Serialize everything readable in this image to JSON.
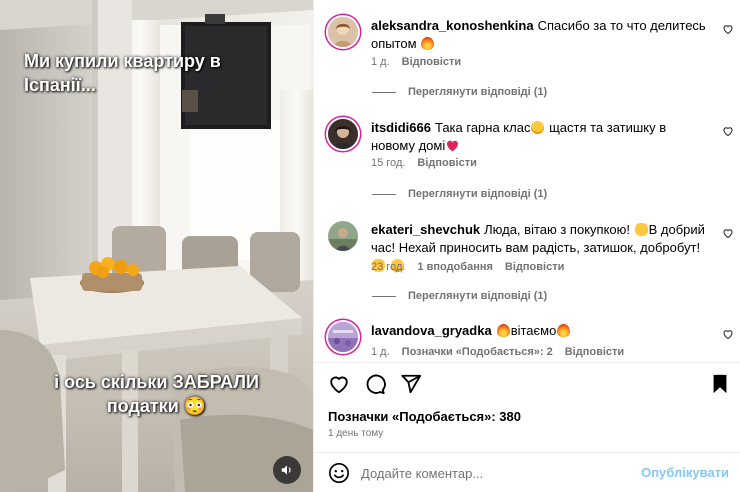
{
  "media": {
    "caption_top": "Ми купили квартиру в Іспанії...",
    "caption_bottom_1": "і ось скільки ЗАБРАЛИ",
    "caption_bottom_2": "податки 😳",
    "sound_icon": "speaker-icon"
  },
  "comments": [
    {
      "username": "aleksandra_konoshenkina",
      "text": "Спасибо за то что делитесь опытом",
      "text_emoji": "fire",
      "age": "1 д.",
      "reply": "Відповісти",
      "likes": "",
      "view_replies": "Переглянути відповіді (1)"
    },
    {
      "username": "itsdidi666",
      "text": "Така гарна клас",
      "text_mid": " щастя та затишку в новому домі",
      "text_emoji": "star-struck",
      "text_emoji_2": "red-heart",
      "age": "15 год.",
      "reply": "Відповісти",
      "likes": "",
      "view_replies": "Переглянути відповіді (1)"
    },
    {
      "username": "ekateri_shevchuk",
      "text": "Люда, вітаю з покупкою! ",
      "text_mid": "В добрий час! Нехай приносить вам радість, затишок, добробут! ",
      "text_emoji": "raising-hands",
      "age": "23 год.",
      "likes": "1 вподобання",
      "reply": "Відповісти",
      "view_replies": "Переглянути відповіді (1)"
    },
    {
      "username": "lavandova_gryadka",
      "text": "вітаємо",
      "text_emoji": "fire",
      "age": "1 д.",
      "likes": "Позначки «Подобається»: 2",
      "reply": "Відповісти"
    }
  ],
  "actions": {
    "like_icon": "heart-icon",
    "comment_icon": "comment-icon",
    "share_icon": "paper-plane-icon",
    "save_icon": "bookmark-icon",
    "likes_text": "Позначки «Подобається»: 380",
    "time": "1 день тому"
  },
  "add_comment": {
    "placeholder": "Додайте коментар...",
    "publish": "Опублікувати",
    "emoji_icon": "smiley-icon"
  },
  "colors": {
    "secondary_text": "#737373",
    "publish_disabled": "#85c7f5",
    "story_ring": "#d6249f"
  }
}
